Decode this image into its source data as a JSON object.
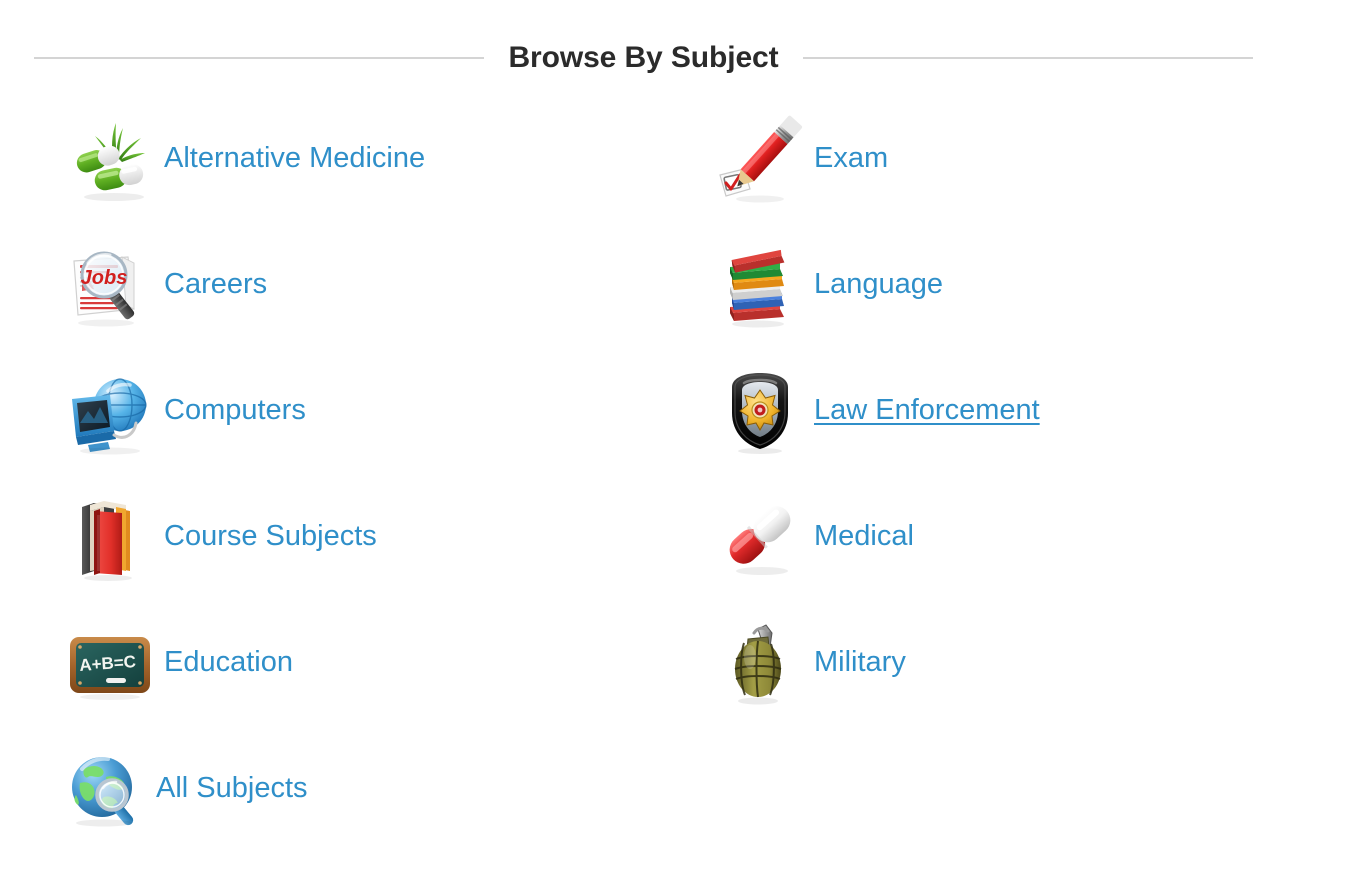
{
  "header": {
    "title": "Browse By Subject",
    "rule_color": "#d4d4d4"
  },
  "theme": {
    "link_color": "#2f8fc9",
    "title_color": "#2b2b2b",
    "background": "#ffffff"
  },
  "subjects": {
    "rows": [
      {
        "left": {
          "label": "Alternative Medicine",
          "icon": "green-capsules-herb-icon",
          "hovered": false
        },
        "right": {
          "label": "Exam",
          "icon": "red-pencil-checkbox-icon",
          "hovered": false
        }
      },
      {
        "left": {
          "label": "Careers",
          "icon": "newspaper-magnifier-jobs-icon",
          "hovered": false
        },
        "right": {
          "label": "Language",
          "icon": "book-stack-icon",
          "hovered": false
        }
      },
      {
        "left": {
          "label": "Computers",
          "icon": "monitor-globe-icon",
          "hovered": false
        },
        "right": {
          "label": "Law Enforcement",
          "icon": "police-shield-badge-icon",
          "hovered": true
        }
      },
      {
        "left": {
          "label": "Course Subjects",
          "icon": "red-books-icon",
          "hovered": false
        },
        "right": {
          "label": "Medical",
          "icon": "red-white-capsule-icon",
          "hovered": false
        }
      },
      {
        "left": {
          "label": "Education",
          "icon": "chalkboard-icon",
          "hovered": false
        },
        "right": {
          "label": "Military",
          "icon": "grenade-icon",
          "hovered": false
        }
      }
    ],
    "footer_item": {
      "label": "All Subjects",
      "icon": "globe-magnifier-icon",
      "hovered": false
    }
  },
  "icon_text": {
    "careers_word": "Jobs",
    "education_equation": "A+B=C"
  }
}
